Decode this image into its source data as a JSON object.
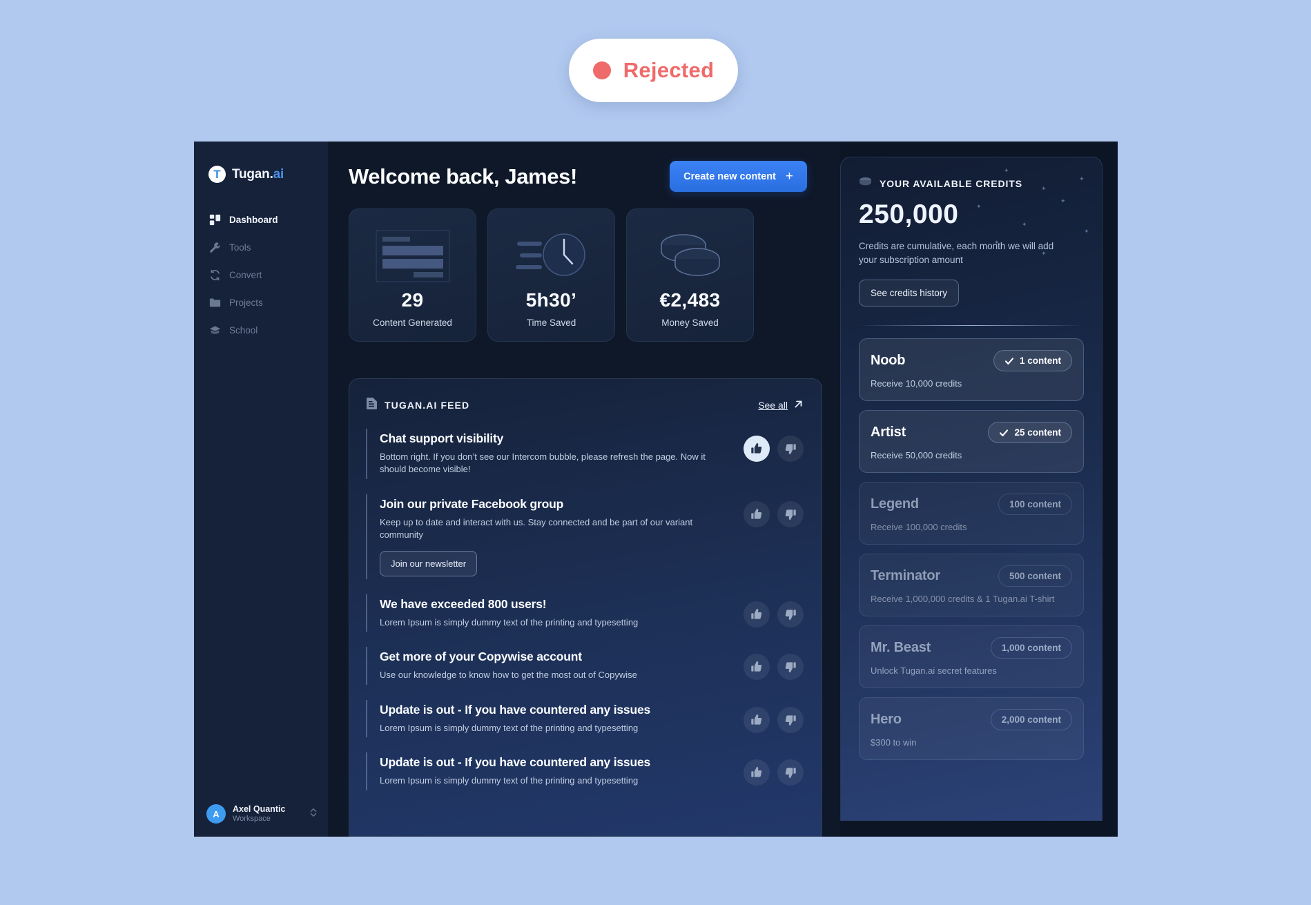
{
  "status_pill": {
    "label": "Rejected",
    "color": "#ef6a6a",
    "icon": "circle-dot-icon"
  },
  "sidebar": {
    "brand": {
      "mark": "T",
      "name": "Tugan.",
      "suffix": "ai"
    },
    "items": [
      {
        "label": "Dashboard",
        "icon": "dashboard-icon",
        "active": true
      },
      {
        "label": "Tools",
        "icon": "wrench-icon",
        "active": false
      },
      {
        "label": "Convert",
        "icon": "refresh-icon",
        "active": false
      },
      {
        "label": "Projects",
        "icon": "folder-icon",
        "active": false
      },
      {
        "label": "School",
        "icon": "graduation-cap-icon",
        "active": false
      }
    ],
    "workspace": {
      "initial": "A",
      "name": "Axel Quantic",
      "subtitle": "Workspace"
    }
  },
  "header": {
    "greeting": "Welcome back, James!",
    "cta_label": "Create new content",
    "cta_icon": "plus-icon",
    "cta_color": "#3b82f6"
  },
  "stats": [
    {
      "value": "29",
      "label": "Content Generated",
      "icon": "document-lines-icon"
    },
    {
      "value": "5h30’",
      "label": "Time Saved",
      "icon": "clock-icon"
    },
    {
      "value": "€2,483",
      "label": "Money Saved",
      "icon": "coins-icon"
    }
  ],
  "feed": {
    "icon": "document-icon",
    "title": "TUGAN.AI FEED",
    "see_all": "See all",
    "see_all_icon": "arrow-up-right-icon",
    "items": [
      {
        "title": "Chat support visibility",
        "desc": "Bottom right. If you don’t see our Intercom bubble, please refresh the page. Now it should become visible!",
        "button": null,
        "liked": true
      },
      {
        "title": "Join our private Facebook group",
        "desc": "Keep up to date and interact with us. Stay connected and be part of our variant community",
        "button": "Join our newsletter",
        "liked": false
      },
      {
        "title": "We have exceeded 800 users!",
        "desc": "Lorem Ipsum is simply dummy text of the printing and typesetting",
        "button": null,
        "liked": false
      },
      {
        "title": "Get more of your Copywise account",
        "desc": "Use our knowledge to know how to get the most out of Copywise",
        "button": null,
        "liked": false
      },
      {
        "title": "Update is out - If you have countered any issues",
        "desc": "Lorem Ipsum is simply dummy text of the printing and typesetting",
        "button": null,
        "liked": false
      },
      {
        "title": "Update is out - If you have countered any issues",
        "desc": "Lorem Ipsum is simply dummy text of the printing and typesetting",
        "button": null,
        "liked": false
      }
    ]
  },
  "credits": {
    "icon": "coin-stack-icon",
    "title": "YOUR AVAILABLE CREDITS",
    "amount": "250,000",
    "note": "Credits are cumulative, each month we will add your subscription amount",
    "history_button": "See credits history",
    "tiers": [
      {
        "name": "Noob",
        "badge": "1 content",
        "sub": "Receive 10,000 credits",
        "checked": true,
        "state": "unlocked"
      },
      {
        "name": "Artist",
        "badge": "25 content",
        "sub": "Receive 50,000 credits",
        "checked": true,
        "state": "unlocked"
      },
      {
        "name": "Legend",
        "badge": "100 content",
        "sub": "Receive 100,000 credits",
        "checked": false,
        "state": "locked"
      },
      {
        "name": "Terminator",
        "badge": "500 content",
        "sub": "Receive 1,000,000 credits & 1 Tugan.ai T-shirt",
        "checked": false,
        "state": "locked"
      },
      {
        "name": "Mr. Beast",
        "badge": "1,000 content",
        "sub": "Unlock Tugan.ai secret features",
        "checked": false,
        "state": "locked"
      },
      {
        "name": "Hero",
        "badge": "2,000 content",
        "sub": "$300 to win",
        "checked": false,
        "state": "locked"
      }
    ]
  }
}
